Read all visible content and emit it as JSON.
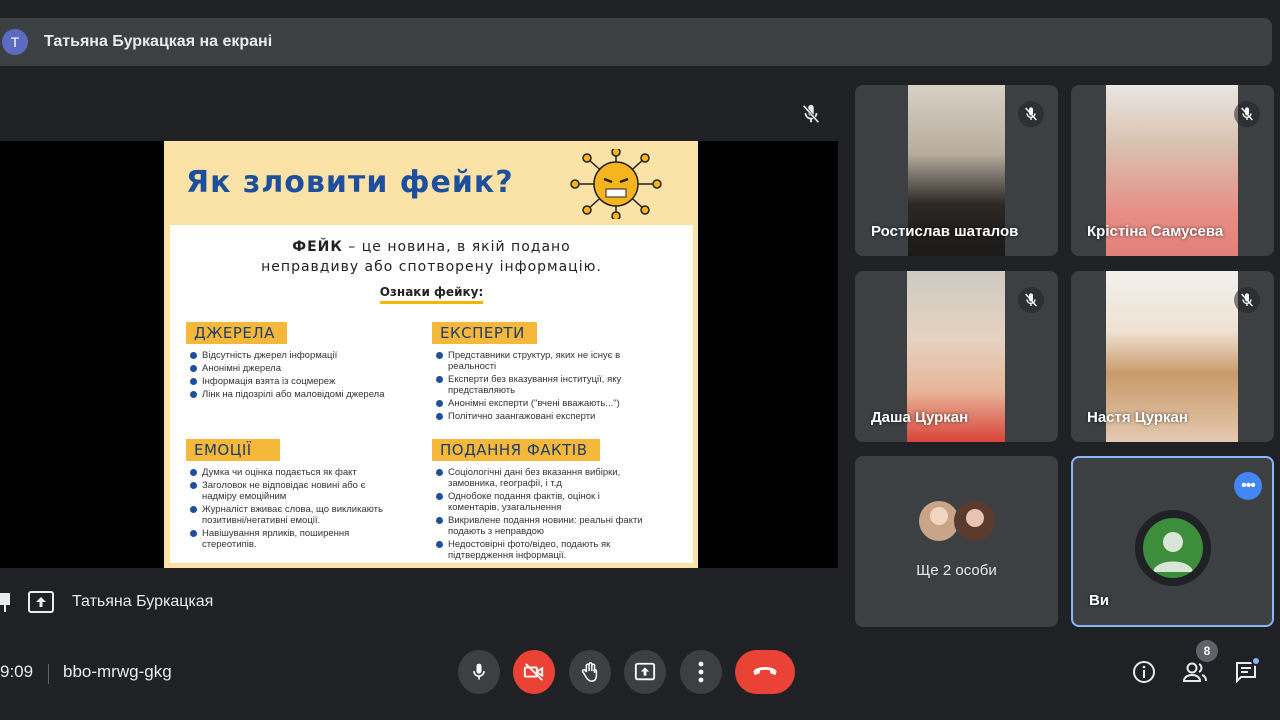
{
  "banner": {
    "avatar_letter": "Т",
    "text": "Татьяна Буркацкая на екрані"
  },
  "slide": {
    "title": "Як зловити фейк?",
    "definition_bold": "ФЕЙК",
    "definition_rest": " – це новина, в якій подано",
    "definition_line2": "неправдиву або спотворену інформацію.",
    "signs_label": "Ознаки фейку:",
    "sections": {
      "sources": {
        "title": "ДЖЕРЕЛА",
        "items": [
          "Відсутність джерел інформації",
          "Анонімні джерела",
          "Інформація взята із соцмереж",
          "Лінк на підозрілі або маловідомі джерела"
        ]
      },
      "experts": {
        "title": "ЕКСПЕРТИ",
        "items": [
          "Представники структур, яких не існує в реальності",
          "Експерти без вказування інституції, яку представляють",
          "Анонімні експерти (\"вчені вважають...\")",
          "Політично заангажовані експерти"
        ]
      },
      "emotions": {
        "title": "ЕМОЦІЇ",
        "items": [
          "Думка чи оцінка подається як факт",
          "Заголовок не відповідає новині або є надміру емоційним",
          "Журналіст вживає слова, що викликають позитивні/негативні емоції.",
          "Навішування ярликів, поширення стереотипів."
        ]
      },
      "facts": {
        "title": "ПОДАННЯ ФАКТІВ",
        "items": [
          "Соціологічні дані без вказання вибірки, замовника, географії, і т.д",
          "Однобоке подання фактів, оцінок і коментарів, узагальнення",
          "Викривлене подання новини: реальні факти подають з неправдою",
          "Недостовірні фото/відео, подають як підтвердження інформації."
        ]
      }
    }
  },
  "participants": [
    {
      "name": "Ростислав шаталов"
    },
    {
      "name": "Крістіна Самусева"
    },
    {
      "name": "Даша Цуркан"
    },
    {
      "name": "Настя Цуркан"
    }
  ],
  "more_people": "Ще 2 особи",
  "self_tile": {
    "name": "Ви"
  },
  "presenter": {
    "name": "Татьяна Буркацкая"
  },
  "meeting": {
    "time": "9:09",
    "code": "bbo-mrwg-gkg"
  },
  "people_count": "8",
  "colors": {
    "accent": "#8ab4f8",
    "danger": "#ea4335",
    "tile": "#3c4043",
    "bg": "#202124"
  }
}
